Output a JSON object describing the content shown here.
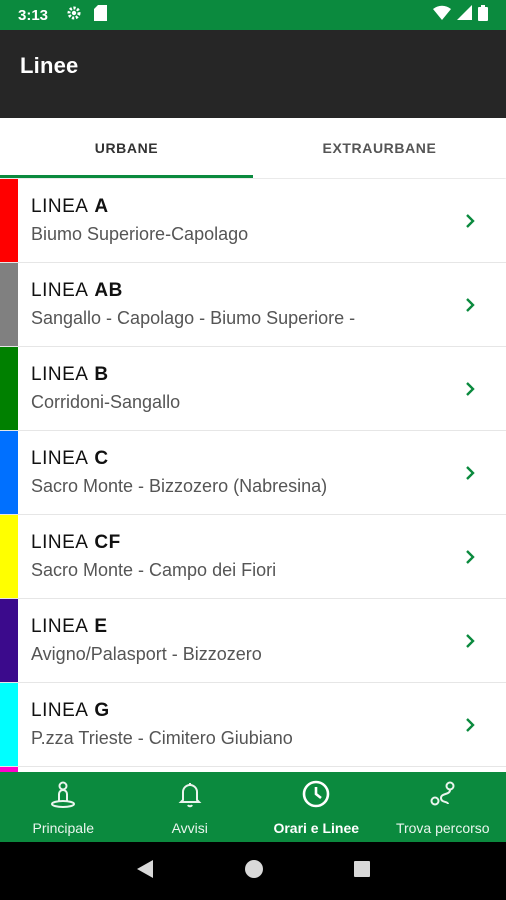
{
  "status_bar": {
    "time": "3:13",
    "icons": [
      "gear-icon",
      "sd-card-icon",
      "wifi-icon",
      "signal-icon",
      "battery-icon"
    ]
  },
  "app_bar": {
    "title": "Linee"
  },
  "tabs": [
    {
      "label": "URBANE",
      "active": true
    },
    {
      "label": "EXTRAURBANE",
      "active": false
    }
  ],
  "lines": [
    {
      "prefix": "LINEA",
      "code": "A",
      "route": "Biumo Superiore-Capolago",
      "color": "#ff0000"
    },
    {
      "prefix": "LINEA",
      "code": "AB",
      "route": "Sangallo - Capolago - Biumo Superiore -",
      "color": "#808080"
    },
    {
      "prefix": "LINEA",
      "code": "B",
      "route": "Corridoni-Sangallo",
      "color": "#008000"
    },
    {
      "prefix": "LINEA",
      "code": "C",
      "route": "Sacro Monte - Bizzozero (Nabresina)",
      "color": "#0070ff"
    },
    {
      "prefix": "LINEA",
      "code": "CF",
      "route": "Sacro Monte - Campo dei Fiori",
      "color": "#ffff00"
    },
    {
      "prefix": "LINEA",
      "code": "E",
      "route": "Avigno/Palasport - Bizzozero",
      "color": "#3b0a8c"
    },
    {
      "prefix": "LINEA",
      "code": "G",
      "route": "P.zza Trieste - Cimitero Giubiano",
      "color": "#00ffff"
    },
    {
      "prefix": "",
      "code": "",
      "route": "",
      "color": "#ff00cc"
    }
  ],
  "bottom_nav": [
    {
      "label": "Principale",
      "icon": "person-pin-icon",
      "active": false
    },
    {
      "label": "Avvisi",
      "icon": "bell-icon",
      "active": false
    },
    {
      "label": "Orari e Linee",
      "icon": "clock-icon",
      "active": true
    },
    {
      "label": "Trova percorso",
      "icon": "route-icon",
      "active": false
    }
  ],
  "colors": {
    "brand_green": "#0b8a3e",
    "app_bar": "#262626",
    "chevron": "#0b8a3e"
  }
}
